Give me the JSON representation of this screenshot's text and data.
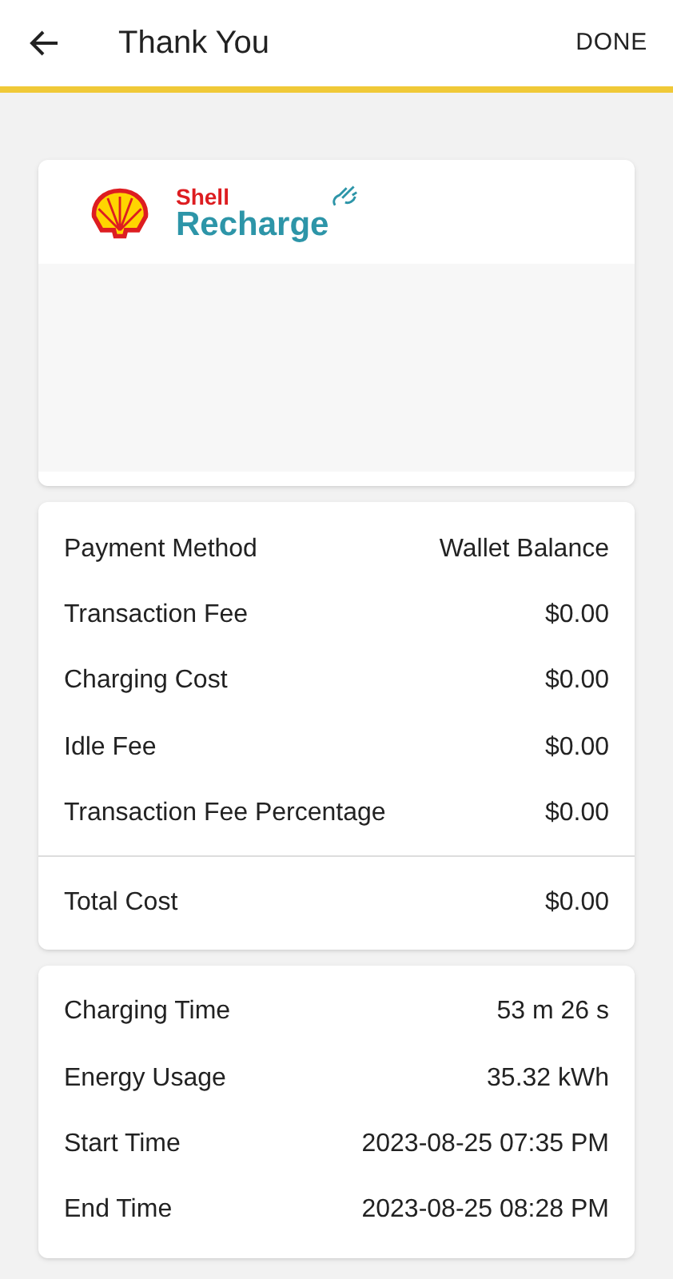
{
  "header": {
    "title": "Thank You",
    "action": "DONE"
  },
  "logo": {
    "brand": "Shell",
    "product": "Recharge"
  },
  "payment_details": [
    {
      "label": "Payment Method",
      "value": "Wallet Balance"
    },
    {
      "label": "Transaction Fee",
      "value": "$0.00"
    },
    {
      "label": "Charging Cost",
      "value": "$0.00"
    },
    {
      "label": "Idle Fee",
      "value": "$0.00"
    },
    {
      "label": "Transaction Fee Percentage",
      "value": "$0.00"
    }
  ],
  "total": {
    "label": "Total Cost",
    "value": "$0.00"
  },
  "session_details": [
    {
      "label": "Charging Time",
      "value": "53 m 26 s"
    },
    {
      "label": "Energy Usage",
      "value": "35.32 kWh"
    },
    {
      "label": "Start Time",
      "value": "2023-08-25 07:35 PM"
    },
    {
      "label": "End Time",
      "value": "2023-08-25 08:28 PM"
    }
  ]
}
